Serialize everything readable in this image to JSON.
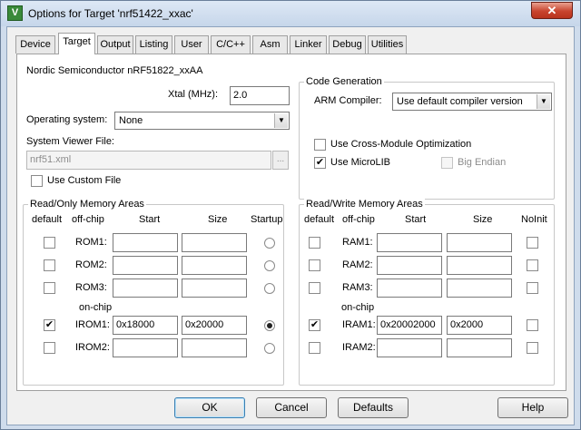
{
  "window": {
    "title": "Options for Target 'nrf51422_xxac'",
    "app_icon": "uvision-icon",
    "close_glyph": "✕"
  },
  "tabs": [
    {
      "label": "Device",
      "active": false
    },
    {
      "label": "Target",
      "active": true
    },
    {
      "label": "Output",
      "active": false
    },
    {
      "label": "Listing",
      "active": false
    },
    {
      "label": "User",
      "active": false
    },
    {
      "label": "C/C++",
      "active": false
    },
    {
      "label": "Asm",
      "active": false
    },
    {
      "label": "Linker",
      "active": false
    },
    {
      "label": "Debug",
      "active": false
    },
    {
      "label": "Utilities",
      "active": false
    }
  ],
  "target": {
    "device_name": "Nordic Semiconductor nRF51822_xxAA",
    "xtal_label": "Xtal (MHz):",
    "xtal_value": "2.0",
    "os_label": "Operating system:",
    "os_value": "None",
    "svf_label": "System Viewer File:",
    "svf_value": "nrf51.xml",
    "browse_label": "...",
    "custom_file_label": "Use Custom File",
    "custom_file_checked": false
  },
  "codegen": {
    "title": "Code Generation",
    "compiler_label": "ARM Compiler:",
    "compiler_value": "Use default compiler version",
    "cross_module_label": "Use Cross-Module Optimization",
    "cross_module_checked": false,
    "microlib_label": "Use MicroLIB",
    "microlib_checked": true,
    "big_endian_label": "Big Endian",
    "big_endian_checked": false
  },
  "rom": {
    "title": "Read/Only Memory Areas",
    "headers": {
      "default": "default",
      "offchip": "off-chip",
      "start": "Start",
      "size": "Size",
      "startup": "Startup"
    },
    "onchip_label": "on-chip",
    "rows": [
      {
        "name": "ROM1:",
        "default": false,
        "start": "",
        "size": "",
        "startup": false
      },
      {
        "name": "ROM2:",
        "default": false,
        "start": "",
        "size": "",
        "startup": false
      },
      {
        "name": "ROM3:",
        "default": false,
        "start": "",
        "size": "",
        "startup": false
      },
      {
        "name": "IROM1:",
        "default": true,
        "start": "0x18000",
        "size": "0x20000",
        "startup": true
      },
      {
        "name": "IROM2:",
        "default": false,
        "start": "",
        "size": "",
        "startup": false
      }
    ]
  },
  "ram": {
    "title": "Read/Write Memory Areas",
    "headers": {
      "default": "default",
      "offchip": "off-chip",
      "start": "Start",
      "size": "Size",
      "noinit": "NoInit"
    },
    "onchip_label": "on-chip",
    "rows": [
      {
        "name": "RAM1:",
        "default": false,
        "start": "",
        "size": "",
        "noinit": false
      },
      {
        "name": "RAM2:",
        "default": false,
        "start": "",
        "size": "",
        "noinit": false
      },
      {
        "name": "RAM3:",
        "default": false,
        "start": "",
        "size": "",
        "noinit": false
      },
      {
        "name": "IRAM1:",
        "default": true,
        "start": "0x20002000",
        "size": "0x2000",
        "noinit": false
      },
      {
        "name": "IRAM2:",
        "default": false,
        "start": "",
        "size": "",
        "noinit": false
      }
    ]
  },
  "buttons": {
    "ok": "OK",
    "cancel": "Cancel",
    "defaults": "Defaults",
    "help": "Help"
  }
}
